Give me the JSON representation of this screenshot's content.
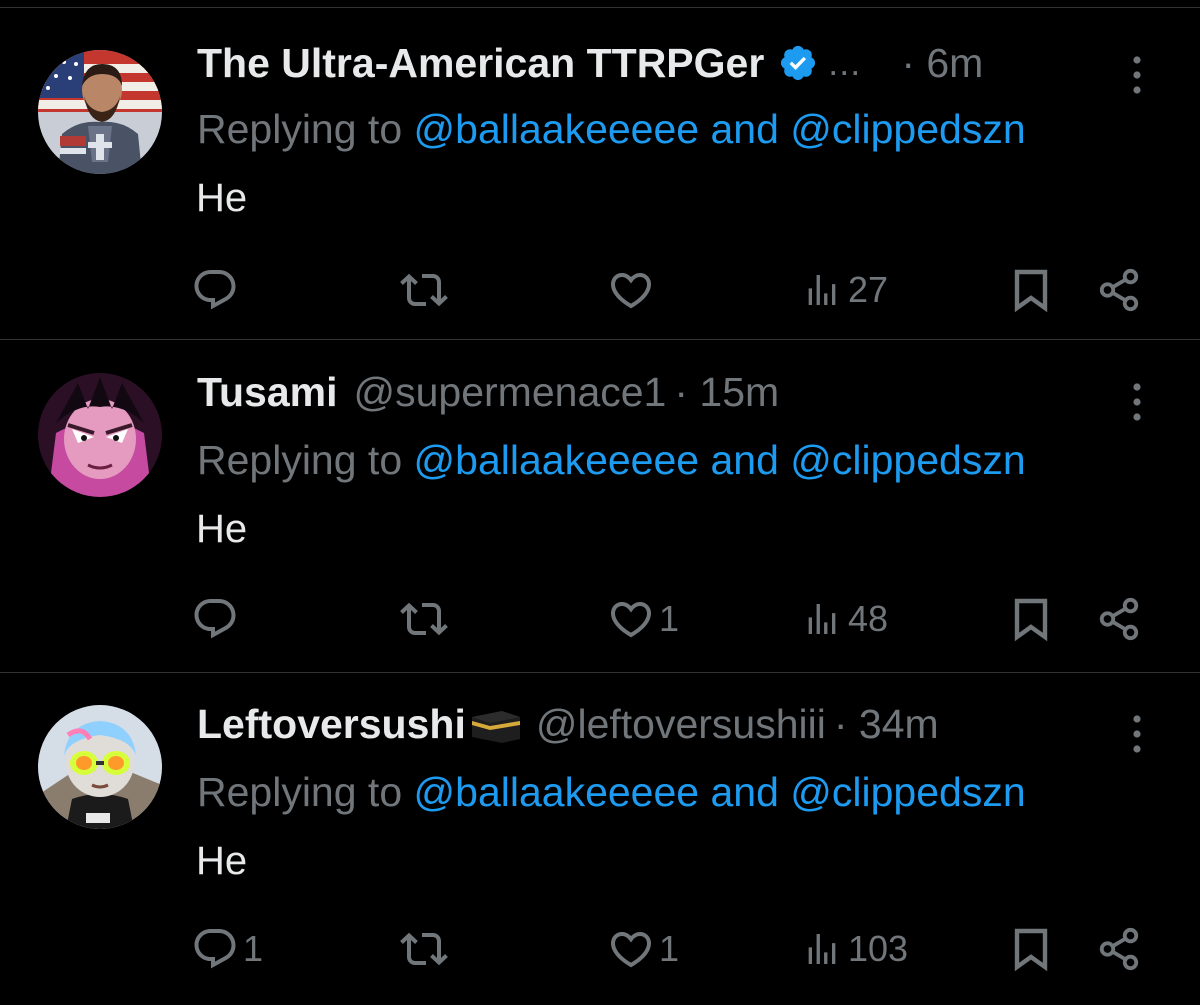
{
  "colors": {
    "background": "#000000",
    "text": "#e7e9ea",
    "muted": "#71767b",
    "link": "#1d9bf0",
    "divider": "#2f3336",
    "verified": "#1d9bf0"
  },
  "tweets": [
    {
      "name": "The Ultra-American TTRPGer",
      "verified": true,
      "handle": "",
      "ellipsis": "...",
      "time": "· 6m",
      "replying_prefix": "Replying to ",
      "mention1": "@ballaakeeeee",
      "and": " and ",
      "mention2": "@clippedszn",
      "text": "He",
      "reply_count": "",
      "retweet_count": "",
      "like_count": "",
      "views": "27",
      "avatar": "patriot-knight-avatar"
    },
    {
      "name": "Tusami",
      "verified": false,
      "handle": "@supermenace1",
      "ellipsis": "",
      "time": "· 15m",
      "replying_prefix": "Replying to ",
      "mention1": "@ballaakeeeee",
      "and": " and ",
      "mention2": "@clippedszn",
      "text": "He",
      "reply_count": "",
      "retweet_count": "",
      "like_count": "1",
      "views": "48",
      "avatar": "anime-character-avatar"
    },
    {
      "name": "Leftoversushi",
      "verified": false,
      "handle": "@leftoversushiii",
      "ellipsis": "",
      "time": "· 34m",
      "replying_prefix": "Replying to ",
      "mention1": "@ballaakeeeee",
      "and": " and ",
      "mention2": "@clippedszn",
      "text": "He",
      "reply_count": "1",
      "retweet_count": "",
      "like_count": "1",
      "views": "103",
      "avatar": "cartoon-glasses-avatar",
      "name_emoji": "kaaba-emoji"
    }
  ],
  "icons": {
    "reply": "reply-icon",
    "retweet": "retweet-icon",
    "like": "heart-icon",
    "views": "views-icon",
    "bookmark": "bookmark-icon",
    "share": "share-icon",
    "more": "more-vertical-icon",
    "verified": "verified-badge-icon"
  }
}
